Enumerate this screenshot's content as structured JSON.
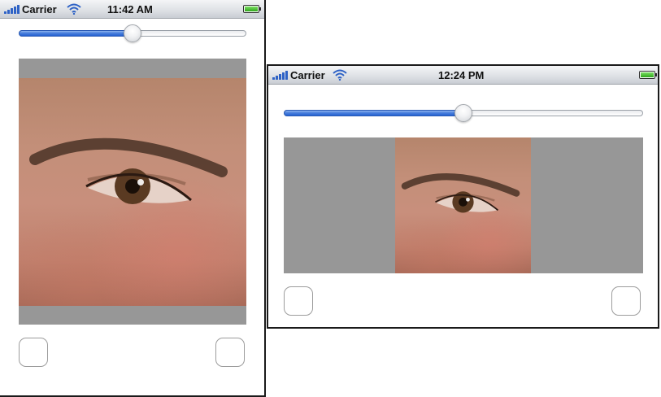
{
  "screens": [
    {
      "orientation": "portrait",
      "status_bar": {
        "carrier": "Carrier",
        "time": "11:42 AM"
      },
      "slider": {
        "value": 0.5
      }
    },
    {
      "orientation": "landscape",
      "status_bar": {
        "carrier": "Carrier",
        "time": "12:24 PM"
      },
      "slider": {
        "value": 0.5
      }
    }
  ],
  "icons": {
    "signal": "signal-bars-icon",
    "wifi": "wifi-icon",
    "battery": "battery-icon"
  },
  "colors": {
    "slider_fill": "#2b65d6",
    "image_background": "#979797",
    "battery_fill": "#3cb521",
    "status_signal": "#2e62c6"
  }
}
